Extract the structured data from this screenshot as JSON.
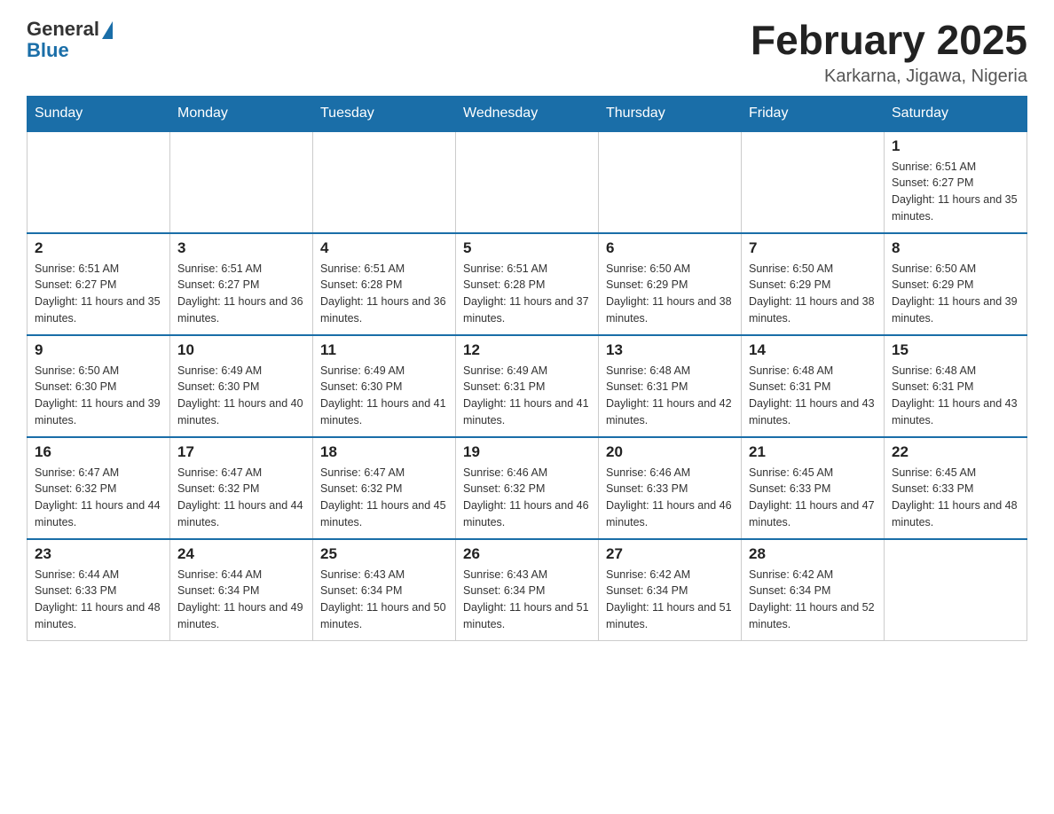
{
  "header": {
    "logo_general": "General",
    "logo_blue": "Blue",
    "title": "February 2025",
    "subtitle": "Karkarna, Jigawa, Nigeria"
  },
  "days_of_week": [
    "Sunday",
    "Monday",
    "Tuesday",
    "Wednesday",
    "Thursday",
    "Friday",
    "Saturday"
  ],
  "weeks": [
    [
      {
        "day": "",
        "info": ""
      },
      {
        "day": "",
        "info": ""
      },
      {
        "day": "",
        "info": ""
      },
      {
        "day": "",
        "info": ""
      },
      {
        "day": "",
        "info": ""
      },
      {
        "day": "",
        "info": ""
      },
      {
        "day": "1",
        "info": "Sunrise: 6:51 AM\nSunset: 6:27 PM\nDaylight: 11 hours and 35 minutes."
      }
    ],
    [
      {
        "day": "2",
        "info": "Sunrise: 6:51 AM\nSunset: 6:27 PM\nDaylight: 11 hours and 35 minutes."
      },
      {
        "day": "3",
        "info": "Sunrise: 6:51 AM\nSunset: 6:27 PM\nDaylight: 11 hours and 36 minutes."
      },
      {
        "day": "4",
        "info": "Sunrise: 6:51 AM\nSunset: 6:28 PM\nDaylight: 11 hours and 36 minutes."
      },
      {
        "day": "5",
        "info": "Sunrise: 6:51 AM\nSunset: 6:28 PM\nDaylight: 11 hours and 37 minutes."
      },
      {
        "day": "6",
        "info": "Sunrise: 6:50 AM\nSunset: 6:29 PM\nDaylight: 11 hours and 38 minutes."
      },
      {
        "day": "7",
        "info": "Sunrise: 6:50 AM\nSunset: 6:29 PM\nDaylight: 11 hours and 38 minutes."
      },
      {
        "day": "8",
        "info": "Sunrise: 6:50 AM\nSunset: 6:29 PM\nDaylight: 11 hours and 39 minutes."
      }
    ],
    [
      {
        "day": "9",
        "info": "Sunrise: 6:50 AM\nSunset: 6:30 PM\nDaylight: 11 hours and 39 minutes."
      },
      {
        "day": "10",
        "info": "Sunrise: 6:49 AM\nSunset: 6:30 PM\nDaylight: 11 hours and 40 minutes."
      },
      {
        "day": "11",
        "info": "Sunrise: 6:49 AM\nSunset: 6:30 PM\nDaylight: 11 hours and 41 minutes."
      },
      {
        "day": "12",
        "info": "Sunrise: 6:49 AM\nSunset: 6:31 PM\nDaylight: 11 hours and 41 minutes."
      },
      {
        "day": "13",
        "info": "Sunrise: 6:48 AM\nSunset: 6:31 PM\nDaylight: 11 hours and 42 minutes."
      },
      {
        "day": "14",
        "info": "Sunrise: 6:48 AM\nSunset: 6:31 PM\nDaylight: 11 hours and 43 minutes."
      },
      {
        "day": "15",
        "info": "Sunrise: 6:48 AM\nSunset: 6:31 PM\nDaylight: 11 hours and 43 minutes."
      }
    ],
    [
      {
        "day": "16",
        "info": "Sunrise: 6:47 AM\nSunset: 6:32 PM\nDaylight: 11 hours and 44 minutes."
      },
      {
        "day": "17",
        "info": "Sunrise: 6:47 AM\nSunset: 6:32 PM\nDaylight: 11 hours and 44 minutes."
      },
      {
        "day": "18",
        "info": "Sunrise: 6:47 AM\nSunset: 6:32 PM\nDaylight: 11 hours and 45 minutes."
      },
      {
        "day": "19",
        "info": "Sunrise: 6:46 AM\nSunset: 6:32 PM\nDaylight: 11 hours and 46 minutes."
      },
      {
        "day": "20",
        "info": "Sunrise: 6:46 AM\nSunset: 6:33 PM\nDaylight: 11 hours and 46 minutes."
      },
      {
        "day": "21",
        "info": "Sunrise: 6:45 AM\nSunset: 6:33 PM\nDaylight: 11 hours and 47 minutes."
      },
      {
        "day": "22",
        "info": "Sunrise: 6:45 AM\nSunset: 6:33 PM\nDaylight: 11 hours and 48 minutes."
      }
    ],
    [
      {
        "day": "23",
        "info": "Sunrise: 6:44 AM\nSunset: 6:33 PM\nDaylight: 11 hours and 48 minutes."
      },
      {
        "day": "24",
        "info": "Sunrise: 6:44 AM\nSunset: 6:34 PM\nDaylight: 11 hours and 49 minutes."
      },
      {
        "day": "25",
        "info": "Sunrise: 6:43 AM\nSunset: 6:34 PM\nDaylight: 11 hours and 50 minutes."
      },
      {
        "day": "26",
        "info": "Sunrise: 6:43 AM\nSunset: 6:34 PM\nDaylight: 11 hours and 51 minutes."
      },
      {
        "day": "27",
        "info": "Sunrise: 6:42 AM\nSunset: 6:34 PM\nDaylight: 11 hours and 51 minutes."
      },
      {
        "day": "28",
        "info": "Sunrise: 6:42 AM\nSunset: 6:34 PM\nDaylight: 11 hours and 52 minutes."
      },
      {
        "day": "",
        "info": ""
      }
    ]
  ]
}
